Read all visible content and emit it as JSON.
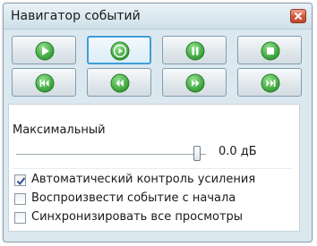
{
  "window": {
    "title": "Навигатор событий"
  },
  "toolbar": {
    "buttons": [
      {
        "name": "play",
        "icon": "play-icon",
        "active": false
      },
      {
        "name": "play-from-start",
        "icon": "play-circle-icon",
        "active": true
      },
      {
        "name": "pause",
        "icon": "pause-icon",
        "active": false
      },
      {
        "name": "stop",
        "icon": "stop-icon",
        "active": false
      },
      {
        "name": "skip-to-start",
        "icon": "skip-back-icon",
        "active": false
      },
      {
        "name": "rewind",
        "icon": "rewind-icon",
        "active": false
      },
      {
        "name": "fast-forward",
        "icon": "fast-forward-icon",
        "active": false
      },
      {
        "name": "skip-to-end",
        "icon": "skip-forward-icon",
        "active": false
      }
    ]
  },
  "volume": {
    "label": "Максимальный",
    "value_text": "0.0 дБ",
    "level": 1.0
  },
  "options": [
    {
      "label": "Автоматический контроль усиления",
      "checked": true
    },
    {
      "label": "Воспроизвести событие с начала",
      "checked": false
    },
    {
      "label": "Синхронизировать все просмотры",
      "checked": false
    }
  ],
  "colors": {
    "button_icon_green": "#3aa83a",
    "window_bg": "#dce8ef",
    "close_red": "#d0583a",
    "active_border": "#3d9ed8"
  }
}
